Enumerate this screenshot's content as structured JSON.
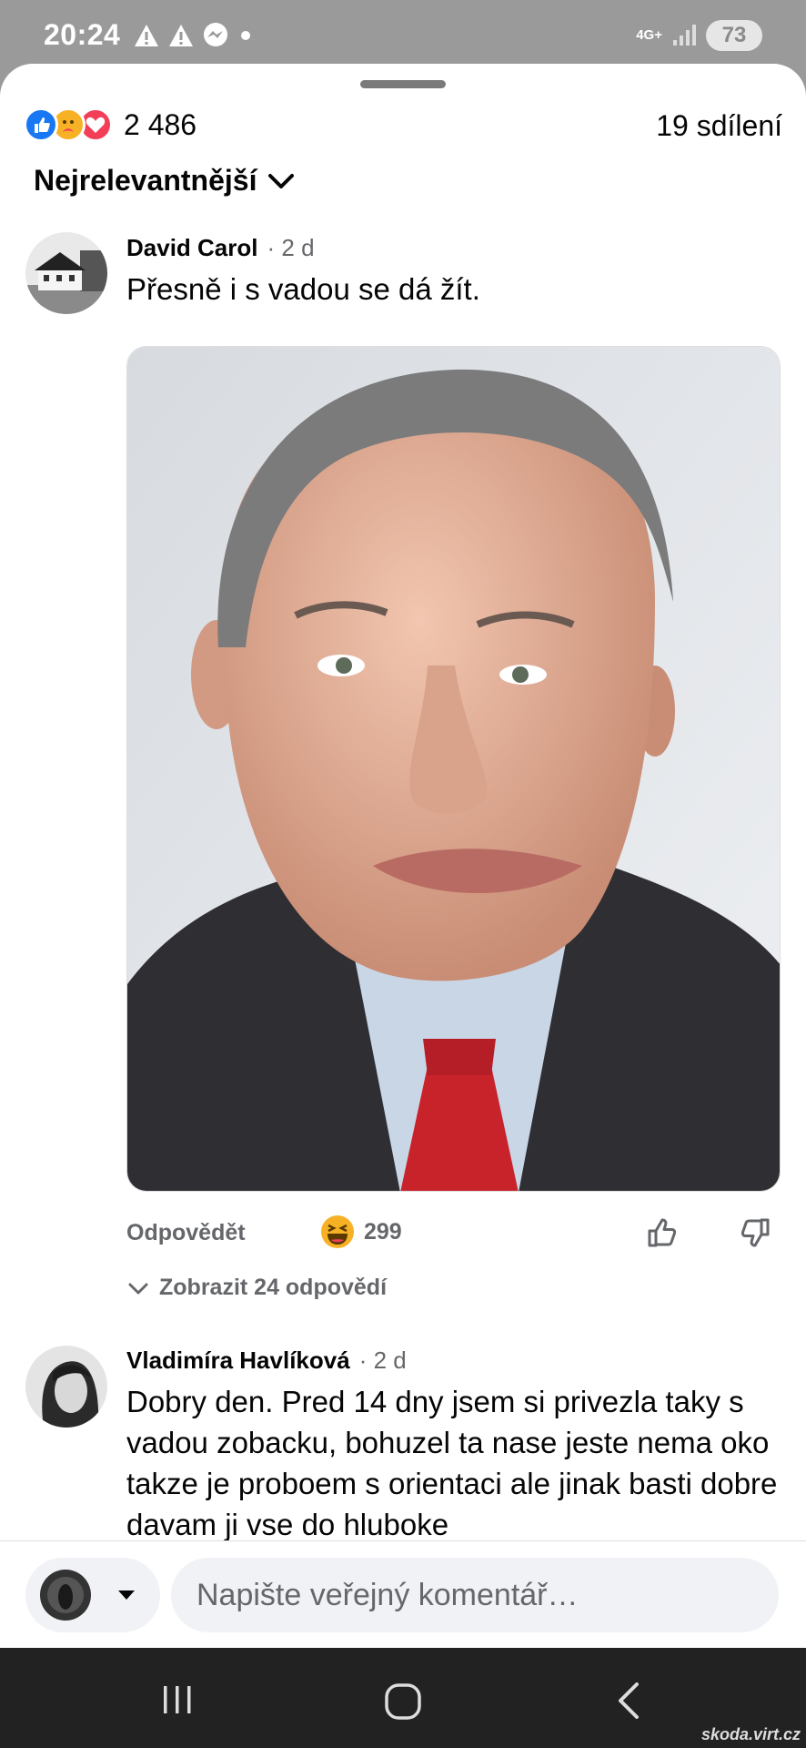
{
  "status_bar": {
    "time": "20:24",
    "network": "4G+",
    "battery": "73",
    "icons": [
      "warning-icon",
      "warning-icon",
      "messenger-icon",
      "dot-icon",
      "signal-icon"
    ]
  },
  "post": {
    "reaction_count": "2 486",
    "reaction_icons": [
      "like-icon",
      "care-icon",
      "love-icon"
    ],
    "shares": "19 sdílení",
    "sort_label": "Nejrelevantnější"
  },
  "comments": [
    {
      "author": "David Carol",
      "time": "· 2 d",
      "text": "Přesně i s vadou se dá žít.",
      "reply_label": "Odpovědět",
      "reaction_count": "299",
      "view_replies": "Zobrazit 24 odpovědí"
    },
    {
      "author": "Vladimíra Havlíková",
      "time": "· 2 d",
      "text": "Dobry den. Pred 14 dny jsem si privezla taky s vadou zobacku, bohuzel ta nase jeste nema oko takze je proboem s orientaci ale jinak basti dobre davam ji vse do hluboke"
    }
  ],
  "composer": {
    "placeholder": "Napište veřejný komentář…"
  },
  "watermark": "skoda.virt.cz",
  "colors": {
    "like": "#1877f2",
    "love": "#f33e58",
    "care": "#f7b125",
    "secondary_text": "#65676b"
  }
}
